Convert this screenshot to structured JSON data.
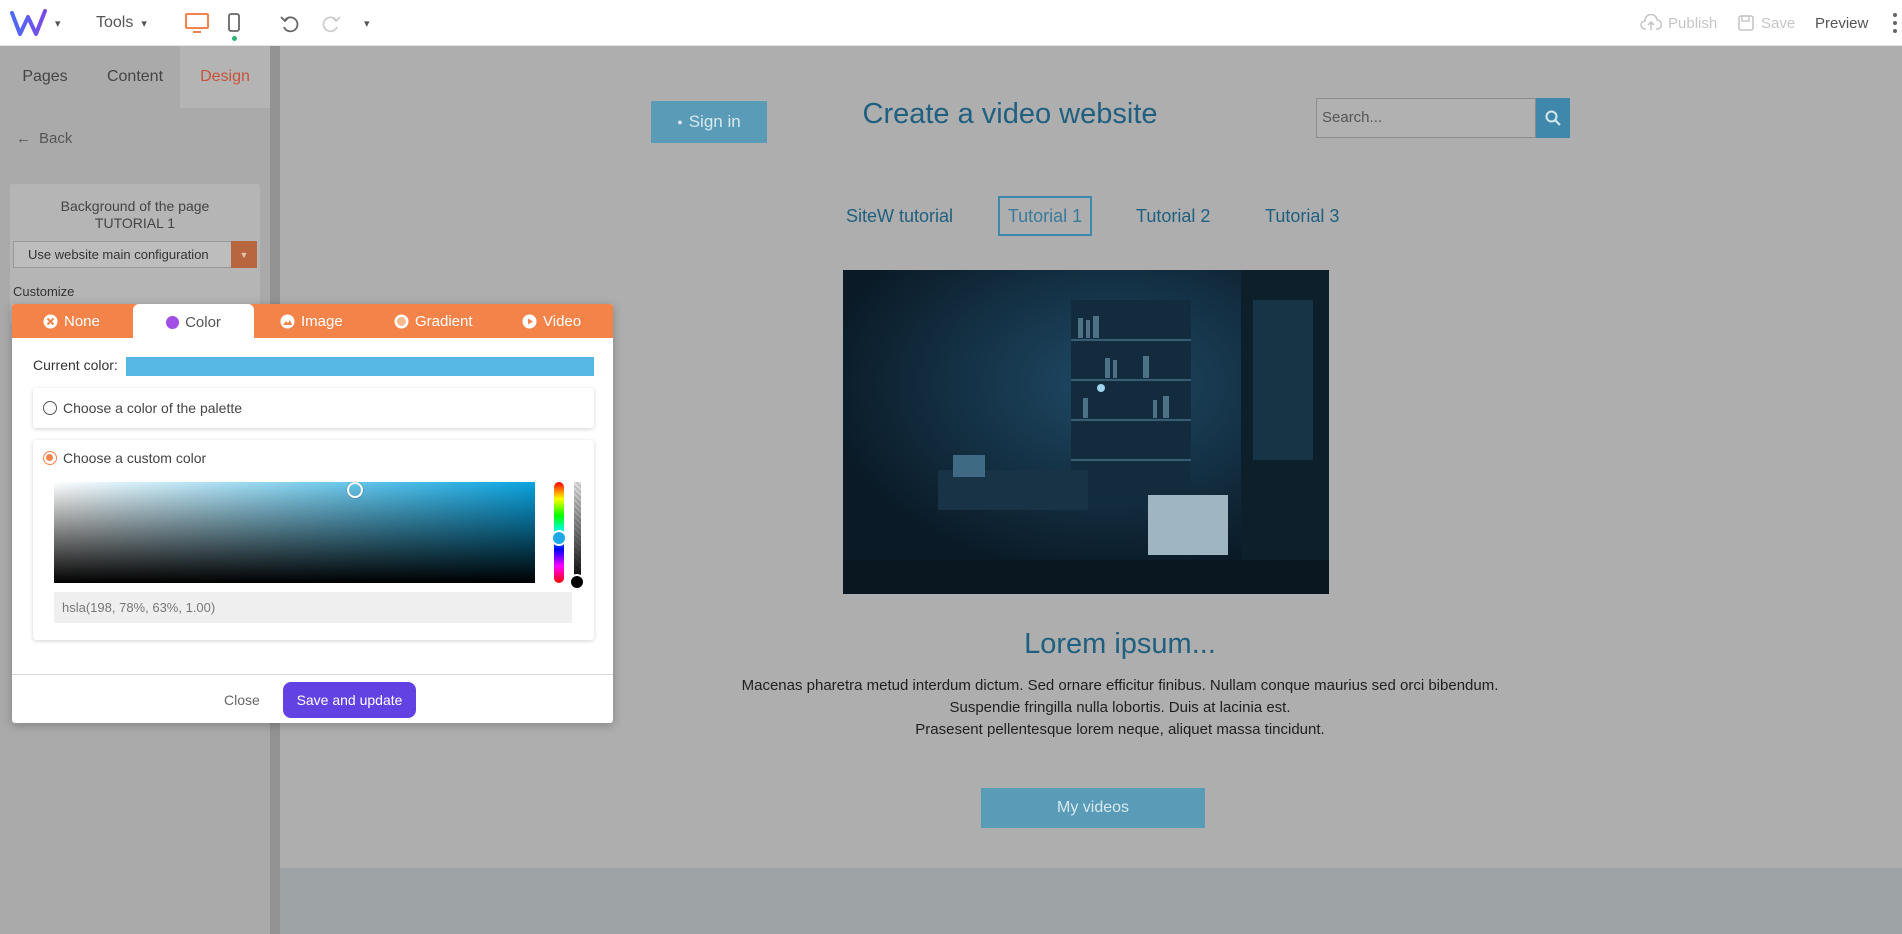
{
  "toolbar": {
    "tools_label": "Tools",
    "publish_label": "Publish",
    "save_label": "Save",
    "preview_label": "Preview"
  },
  "sidebar": {
    "tabs": [
      {
        "label": "Pages"
      },
      {
        "label": "Content"
      },
      {
        "label": "Design"
      }
    ],
    "back_label": "Back",
    "card_title_line1": "Background of the page",
    "card_title_line2": "TUTORIAL 1",
    "select_value": "Use website main configuration",
    "customize_label": "Customize"
  },
  "site": {
    "signin_label": "Sign in",
    "title": "Create a video website",
    "search_placeholder": "Search...",
    "nav": [
      "SiteW tutorial",
      "Tutorial 1",
      "Tutorial 2",
      "Tutorial 3"
    ],
    "heading": "Lorem ipsum...",
    "paragraph_lines": [
      "Macenas pharetra metud interdum dictum. Sed ornare efficitur finibus. Nullam conque maurius sed orci bibendum.",
      "Suspendie fringilla nulla lobortis. Duis at lacinia est.",
      "Prasesent pellentesque lorem neque, aliquet massa tincidunt."
    ],
    "cta_label": "My videos"
  },
  "modal": {
    "tabs": [
      {
        "label": "None"
      },
      {
        "label": "Color"
      },
      {
        "label": "Image"
      },
      {
        "label": "Gradient"
      },
      {
        "label": "Video"
      }
    ],
    "current_color_label": "Current color:",
    "current_color": "#57b8e6",
    "option_palette_label": "Choose a color of the palette",
    "option_custom_label": "Choose a custom color",
    "color_value": "hsla(198, 78%, 63%, 1.00)",
    "close_label": "Close",
    "save_update_label": "Save and update"
  },
  "colors": {
    "accent_orange": "#f4834a",
    "primary_purple": "#6342e4",
    "site_blue": "#1f5f7f"
  }
}
